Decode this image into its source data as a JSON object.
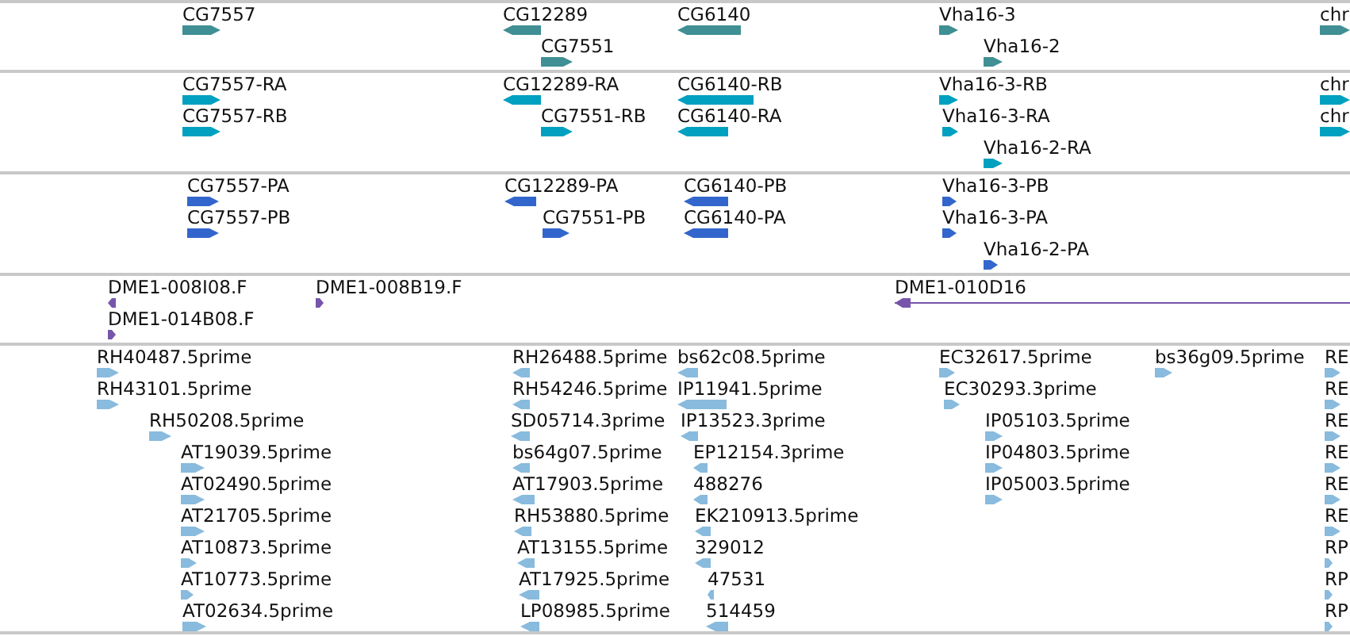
{
  "tracks": [
    {
      "color": "#3f8f94",
      "features": [
        {
          "label": "CG7557",
          "kind": "forward"
        },
        {
          "label": "CG12289",
          "kind": "reverse"
        },
        {
          "label": "CG7551",
          "kind": "forward"
        },
        {
          "label": "CG6140",
          "kind": "reverse"
        },
        {
          "label": "Vha16-3",
          "kind": "forward"
        },
        {
          "label": "Vha16-2",
          "kind": "forward"
        },
        {
          "label": "chr",
          "kind": "forward"
        }
      ]
    },
    {
      "color": "#00a0c0",
      "features": [
        {
          "label": "CG7557-RA",
          "kind": "forward"
        },
        {
          "label": "CG7557-RB",
          "kind": "forward"
        },
        {
          "label": "CG12289-RA",
          "kind": "reverse"
        },
        {
          "label": "CG7551-RB",
          "kind": "forward"
        },
        {
          "label": "CG6140-RB",
          "kind": "reverse"
        },
        {
          "label": "CG6140-RA",
          "kind": "reverse"
        },
        {
          "label": "Vha16-3-RB",
          "kind": "forward"
        },
        {
          "label": "Vha16-3-RA",
          "kind": "forward"
        },
        {
          "label": "Vha16-2-RA",
          "kind": "forward"
        },
        {
          "label": "chr",
          "kind": "forward"
        },
        {
          "label": "chr",
          "kind": "forward"
        }
      ]
    },
    {
      "color": "#3366cc",
      "features": [
        {
          "label": "CG7557-PA",
          "kind": "forward"
        },
        {
          "label": "CG7557-PB",
          "kind": "forward"
        },
        {
          "label": "CG12289-PA",
          "kind": "reverse"
        },
        {
          "label": "CG7551-PB",
          "kind": "forward"
        },
        {
          "label": "CG6140-PB",
          "kind": "reverse"
        },
        {
          "label": "CG6140-PA",
          "kind": "reverse"
        },
        {
          "label": "Vha16-3-PB",
          "kind": "forward"
        },
        {
          "label": "Vha16-3-PA",
          "kind": "forward"
        },
        {
          "label": "Vha16-2-PA",
          "kind": "forward"
        }
      ]
    },
    {
      "color": "#7755aa",
      "features": [
        {
          "label": "DME1-008I08.F",
          "kind": "reverse"
        },
        {
          "label": "DME1-014B08.F",
          "kind": "forward"
        },
        {
          "label": "DME1-008B19.F",
          "kind": "forward"
        },
        {
          "label": "DME1-010D16",
          "kind": "reverse"
        }
      ]
    },
    {
      "color": "#88bbdd",
      "features": [
        {
          "label": "RH40487.5prime",
          "kind": "forward"
        },
        {
          "label": "RH43101.5prime",
          "kind": "forward"
        },
        {
          "label": "RH50208.5prime",
          "kind": "forward"
        },
        {
          "label": "AT19039.5prime",
          "kind": "forward"
        },
        {
          "label": "AT02490.5prime",
          "kind": "forward"
        },
        {
          "label": "AT21705.5prime",
          "kind": "forward"
        },
        {
          "label": "AT10873.5prime",
          "kind": "forward"
        },
        {
          "label": "AT10773.5prime",
          "kind": "forward"
        },
        {
          "label": "AT02634.5prime",
          "kind": "forward"
        },
        {
          "label": "RH26488.5prime",
          "kind": "reverse"
        },
        {
          "label": "RH54246.5prime",
          "kind": "reverse"
        },
        {
          "label": "SD05714.3prime",
          "kind": "reverse"
        },
        {
          "label": "bs64g07.5prime",
          "kind": "reverse"
        },
        {
          "label": "AT17903.5prime",
          "kind": "reverse"
        },
        {
          "label": "RH53880.5prime",
          "kind": "reverse"
        },
        {
          "label": "AT13155.5prime",
          "kind": "reverse"
        },
        {
          "label": "AT17925.5prime",
          "kind": "reverse"
        },
        {
          "label": "LP08985.5prime",
          "kind": "reverse"
        },
        {
          "label": "bs62c08.5prime",
          "kind": "reverse"
        },
        {
          "label": "IP11941.5prime",
          "kind": "reverse"
        },
        {
          "label": "IP13523.3prime",
          "kind": "reverse"
        },
        {
          "label": "EP12154.3prime",
          "kind": "reverse"
        },
        {
          "label": "488276",
          "kind": "reverse"
        },
        {
          "label": "EK210913.5prime",
          "kind": "reverse"
        },
        {
          "label": "329012",
          "kind": "reverse"
        },
        {
          "label": "47531",
          "kind": "reverse"
        },
        {
          "label": "514459",
          "kind": "reverse"
        },
        {
          "label": "EC32617.5prime",
          "kind": "forward"
        },
        {
          "label": "EC30293.3prime",
          "kind": "forward"
        },
        {
          "label": "IP05103.5prime",
          "kind": "forward"
        },
        {
          "label": "IP04803.5prime",
          "kind": "forward"
        },
        {
          "label": "IP05003.5prime",
          "kind": "forward"
        },
        {
          "label": "bs36g09.5prime",
          "kind": "forward"
        },
        {
          "label": "RE",
          "kind": "forward"
        },
        {
          "label": "RE",
          "kind": "forward"
        },
        {
          "label": "RE",
          "kind": "forward"
        },
        {
          "label": "RE",
          "kind": "forward"
        },
        {
          "label": "RE",
          "kind": "forward"
        },
        {
          "label": "RE",
          "kind": "forward"
        },
        {
          "label": "RP",
          "kind": "forward"
        },
        {
          "label": "RP",
          "kind": "forward"
        },
        {
          "label": "RP",
          "kind": "forward"
        }
      ]
    }
  ]
}
